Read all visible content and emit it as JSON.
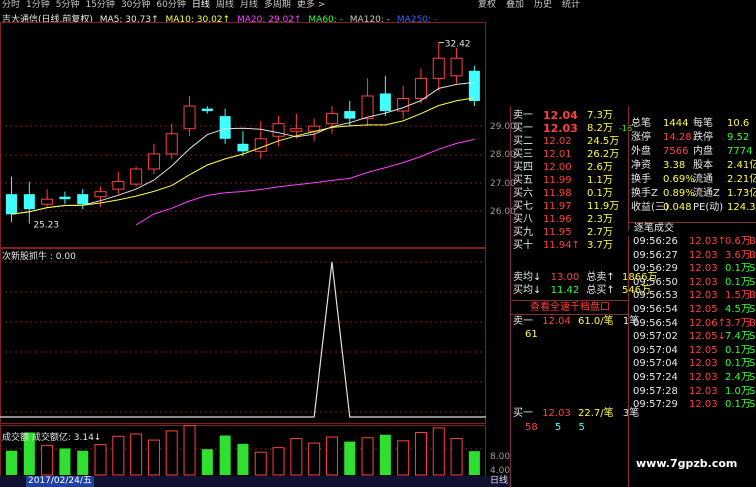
{
  "toolbar": {
    "left_items": [
      "分时",
      "1分钟",
      "5分钟",
      "15分钟",
      "30分钟",
      "60分钟",
      "日线",
      "周线",
      "月线",
      "多周期",
      "更多 >"
    ],
    "active": "日线",
    "right_items": [
      "复权",
      "叠加",
      "历史",
      "统计"
    ]
  },
  "indicator_line": {
    "stock_name": "吉大通信(日线,前复权)",
    "ma5": "MA5: 30.73↑",
    "ma10": "MA10: 30.02↑",
    "ma20": "MA20: 29.02↑",
    "ma60": "MA60: -",
    "ma120": "MA120: -",
    "ma250": "MA250: -"
  },
  "colors": {
    "up": "#ff4040",
    "down": "#40ffff",
    "ma5": "#e0e0e0",
    "ma10": "#ffff40",
    "ma20": "#ff40ff",
    "ma60": "#40ff40"
  },
  "price_labels": {
    "high": "32.42",
    "low": "25.23"
  },
  "price_axis": [
    "29.00",
    "28.00",
    "27.00",
    "26.00"
  ],
  "sub1": {
    "title": "次新股抓牛 : 0.00"
  },
  "sub2": {
    "title": "成交额 成交额亿: 3.14↓",
    "axis": [
      "8.00",
      "4.00"
    ]
  },
  "bottom_bar": {
    "date": "2017/02/24/五",
    "tab": "日线"
  },
  "order_book": {
    "sells": [
      {
        "label": "卖一",
        "price": "12.04",
        "vol": "7.3万"
      },
      {
        "label": "买一",
        "price": "12.03",
        "vol": "8.2万",
        "chg": "-16"
      },
      {
        "label": "买二",
        "price": "12.02",
        "vol": "24.5万"
      },
      {
        "label": "买三",
        "price": "12.01",
        "vol": "26.2万"
      },
      {
        "label": "买四",
        "price": "12.00",
        "vol": "2.6万"
      },
      {
        "label": "买五",
        "price": "11.99",
        "vol": "1.1万"
      },
      {
        "label": "买六",
        "price": "11.98",
        "vol": "0.1万"
      },
      {
        "label": "买七",
        "price": "11.97",
        "vol": "11.9万"
      },
      {
        "label": "买八",
        "price": "11.96",
        "vol": "2.3万"
      },
      {
        "label": "买九",
        "price": "11.95",
        "vol": "2.7万"
      },
      {
        "label": "买十",
        "price": "11.94↑",
        "vol": "3.7万"
      }
    ],
    "avg_sell": {
      "label": "卖均↓",
      "price": "13.00",
      "tot_label": "总卖↑",
      "tot": "1866万"
    },
    "avg_buy": {
      "label": "买均↓",
      "price": "11.42",
      "tot_label": "总买↑",
      "tot": "546万"
    },
    "link": "查看全速千档盘口",
    "sell1_detail": {
      "label": "卖一",
      "price": "12.04",
      "vol": "61.0/笔",
      "count": "1笔",
      "sub": "61"
    },
    "buy1_detail": {
      "label": "买一",
      "price": "12.03",
      "vol": "22.7/笔",
      "count": "3笔",
      "sub": [
        "58",
        "5",
        "5"
      ]
    }
  },
  "stats": [
    {
      "k": "总笔",
      "v": "1444",
      "k2": "每笔",
      "v2": "10.6"
    },
    {
      "k": "涨停",
      "v": "14.28",
      "k2": "跌停",
      "v2": "9.52"
    },
    {
      "k": "外盘",
      "v": "7566",
      "k2": "内盘",
      "v2": "7774"
    },
    {
      "k": "净资",
      "v": "3.38",
      "k2": "股本",
      "v2": "2.41亿"
    },
    {
      "k": "换手",
      "v": "0.69%",
      "k2": "流通",
      "v2": "2.21亿"
    },
    {
      "k": "换手Z",
      "v": "0.89%",
      "k2": "流通Z",
      "v2": "1.73亿"
    },
    {
      "k": "收益(三)",
      "v": "0.048",
      "k2": "PE(动)",
      "v2": "124.3"
    }
  ],
  "ticks_title": "逐笔成交",
  "ticks": [
    {
      "t": "09:56:26",
      "p": "12.03↑",
      "v": "0.6万",
      "f": "B"
    },
    {
      "t": "09:56:27",
      "p": "12.03",
      "v": "3.6万",
      "f": "B"
    },
    {
      "t": "09:56:29",
      "p": "12.03",
      "v": "0.1万",
      "f": "S"
    },
    {
      "t": "09:56:50",
      "p": "12.03",
      "v": "0.1万",
      "f": "S"
    },
    {
      "t": "09:56:53",
      "p": "12.03",
      "v": "1.5万",
      "f": "B"
    },
    {
      "t": "09:56:54",
      "p": "12.05",
      "v": "4.5万",
      "f": "S"
    },
    {
      "t": "09:56:54",
      "p": "12.06↑",
      "v": "3.7万",
      "f": "B"
    },
    {
      "t": "09:57:02",
      "p": "12.05↓",
      "v": "7.4万",
      "f": "S"
    },
    {
      "t": "09:57:04",
      "p": "12.05",
      "v": "0.1万",
      "f": "S"
    },
    {
      "t": "09:57:04",
      "p": "12.03",
      "v": "0.1万",
      "f": "S"
    },
    {
      "t": "09:57:24",
      "p": "12.03",
      "v": "2.4万",
      "f": "S"
    },
    {
      "t": "09:57:28",
      "p": "12.03",
      "v": "1.0万",
      "f": "S"
    },
    {
      "t": "09:57:29",
      "p": "12.03",
      "v": "0.1万",
      "f": "S"
    }
  ],
  "watermark": "www.7gpzb.com",
  "chart_data": [
    {
      "type": "candlestick",
      "title": "吉大通信(日线,前复权)",
      "candles": [
        [
          26.4,
          27.1,
          25.6,
          25.3,
          "down"
        ],
        [
          26.4,
          26.9,
          25.8,
          25.23,
          "down"
        ],
        [
          26.0,
          26.6,
          26.2,
          25.9,
          "up"
        ],
        [
          26.3,
          26.5,
          26.2,
          26.0,
          "down"
        ],
        [
          26.4,
          26.6,
          26.0,
          25.8,
          "down"
        ],
        [
          26.3,
          26.7,
          26.5,
          25.9,
          "up"
        ],
        [
          26.6,
          27.3,
          26.9,
          26.4,
          "up"
        ],
        [
          26.8,
          27.5,
          27.4,
          26.7,
          "up"
        ],
        [
          27.4,
          28.4,
          28.0,
          27.2,
          "up"
        ],
        [
          28.0,
          29.2,
          28.8,
          27.8,
          "up"
        ],
        [
          29.0,
          30.3,
          29.9,
          28.7,
          "up"
        ],
        [
          29.8,
          29.9,
          29.7,
          29.6,
          "down"
        ],
        [
          29.5,
          29.8,
          28.6,
          28.4,
          "down"
        ],
        [
          28.4,
          28.9,
          28.1,
          27.9,
          "down"
        ],
        [
          28.1,
          29.3,
          28.6,
          27.8,
          "up"
        ],
        [
          28.7,
          29.5,
          29.2,
          28.3,
          "up"
        ],
        [
          29.0,
          29.6,
          28.9,
          28.6,
          "up"
        ],
        [
          28.9,
          29.4,
          29.1,
          28.5,
          "up"
        ],
        [
          29.2,
          29.9,
          29.6,
          28.8,
          "up"
        ],
        [
          29.7,
          30.1,
          29.4,
          29.1,
          "down"
        ],
        [
          29.4,
          31.0,
          30.3,
          29.1,
          "up"
        ],
        [
          30.4,
          31.1,
          29.7,
          29.5,
          "down"
        ],
        [
          29.7,
          30.7,
          30.2,
          29.4,
          "up"
        ],
        [
          30.2,
          31.4,
          31.0,
          30.0,
          "up"
        ],
        [
          31.0,
          32.42,
          31.8,
          30.5,
          "up"
        ],
        [
          31.8,
          32.2,
          31.1,
          30.8,
          "up"
        ],
        [
          31.3,
          31.5,
          30.1,
          29.9,
          "down"
        ]
      ]
    },
    {
      "type": "bar",
      "title": "成交额",
      "values": [
        3.2,
        5.6,
        3.9,
        3.5,
        3.2,
        4.0,
        5.1,
        5.4,
        4.6,
        5.8,
        6.5,
        3.4,
        5.2,
        4.1,
        3.0,
        3.6,
        4.8,
        4.2,
        5.0,
        4.4,
        4.9,
        5.3,
        4.5,
        5.6,
        6.2,
        4.8,
        3.14
      ],
      "ylim": [
        0,
        8
      ]
    }
  ]
}
